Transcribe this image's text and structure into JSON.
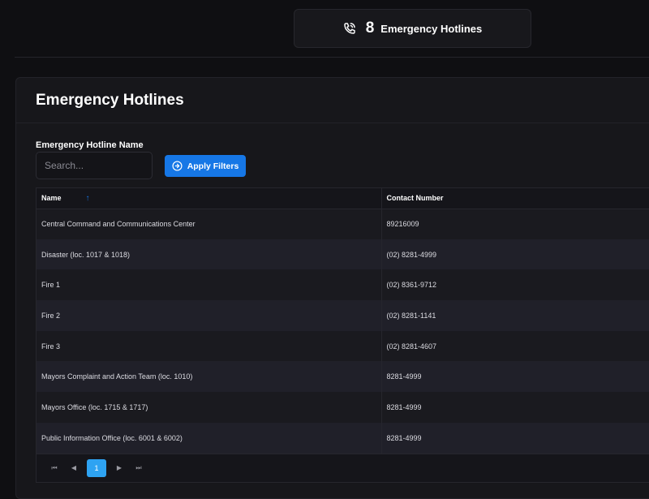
{
  "stat": {
    "count": "8",
    "label": "Emergency Hotlines",
    "icon": "phone-call-icon"
  },
  "panel": {
    "title": "Emergency Hotlines"
  },
  "filters": {
    "label": "Emergency Hotline Name",
    "search_placeholder": "Search...",
    "search_value": "",
    "apply_label": "Apply Filters"
  },
  "table": {
    "columns": [
      "Name",
      "Contact Number"
    ],
    "sort_indicator": "↑",
    "rows": [
      {
        "name": "Central Command and Communications Center",
        "contact": "89216009"
      },
      {
        "name": "Disaster (loc. 1017 & 1018)",
        "contact": "(02) 8281-4999"
      },
      {
        "name": "Fire 1",
        "contact": "(02) 8361-9712"
      },
      {
        "name": "Fire 2",
        "contact": "(02) 8281-1141"
      },
      {
        "name": "Fire 3",
        "contact": "(02) 8281-4607"
      },
      {
        "name": "Mayors Complaint and Action Team (loc. 1010)",
        "contact": "8281-4999"
      },
      {
        "name": "Mayors Office (loc. 1715 & 1717)",
        "contact": "8281-4999"
      },
      {
        "name": "Public Information Office (loc. 6001 & 6002)",
        "contact": "8281-4999"
      }
    ]
  },
  "pagination": {
    "current_page": "1",
    "first": "⏮",
    "prev": "◀",
    "next": "▶",
    "last": "⏭"
  },
  "colors": {
    "accent": "#1677e6",
    "page_active": "#2ea3f2",
    "background": "#0f0f12"
  }
}
